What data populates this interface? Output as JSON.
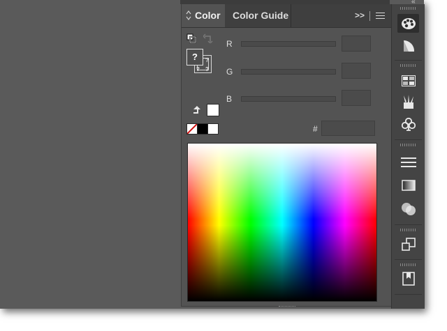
{
  "tabs": [
    {
      "label": "Color",
      "active": true
    },
    {
      "label": "Color Guide",
      "active": false
    }
  ],
  "panel_controls": {
    "expand_glyph": ">>"
  },
  "fill_stroke": {
    "unknown_glyph": "?"
  },
  "channels": [
    {
      "label": "R",
      "value": ""
    },
    {
      "label": "G",
      "value": ""
    },
    {
      "label": "B",
      "value": ""
    }
  ],
  "hex": {
    "label": "#",
    "value": ""
  },
  "dock_icons": [
    "color-palette-icon",
    "color-guide-icon",
    "swatches-icon",
    "brushes-icon",
    "symbols-icon",
    "stroke-icon",
    "gradient-icon",
    "transparency-icon",
    "artboards-icon",
    "layers-icon"
  ],
  "colors": {
    "panel_bg": "#535353",
    "tabbar_bg": "#3f3f3f",
    "dock_bg": "#444444",
    "workspace_bg": "#5a5a5a"
  }
}
